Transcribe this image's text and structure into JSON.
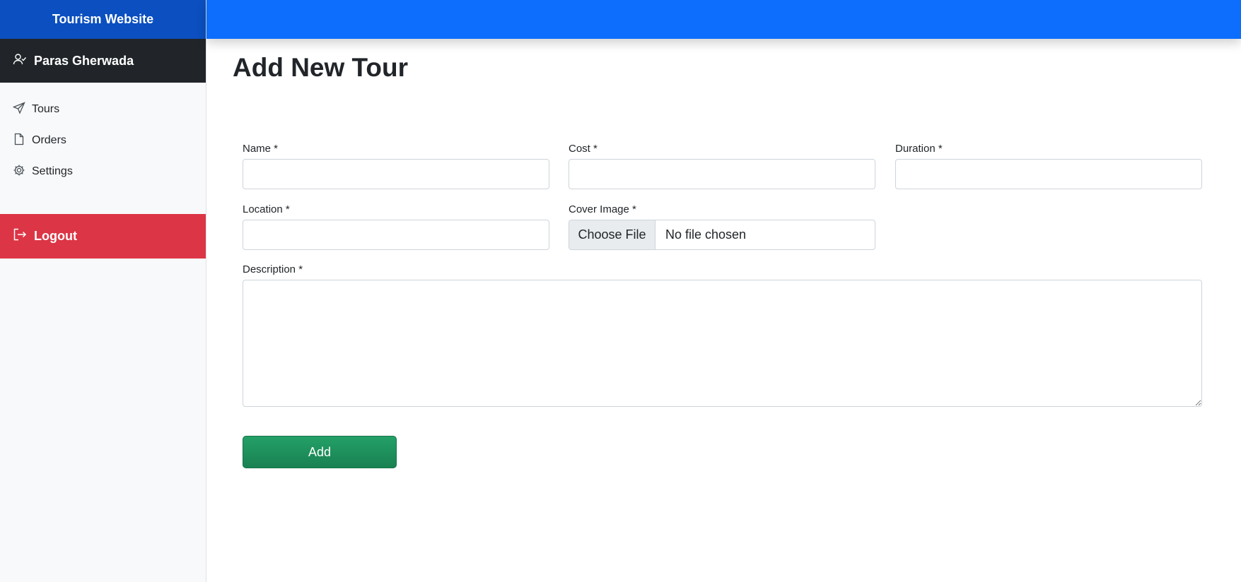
{
  "sidebar": {
    "brand": "Tourism Website",
    "user_name": "Paras Gherwada",
    "items": [
      {
        "label": "Tours",
        "icon": "send-icon"
      },
      {
        "label": "Orders",
        "icon": "file-icon"
      },
      {
        "label": "Settings",
        "icon": "gear-icon"
      }
    ],
    "logout_label": "Logout"
  },
  "main": {
    "title": "Add New Tour",
    "fields": {
      "name": {
        "label": "Name *",
        "value": ""
      },
      "cost": {
        "label": "Cost *",
        "value": ""
      },
      "duration": {
        "label": "Duration *",
        "value": ""
      },
      "location": {
        "label": "Location *",
        "value": ""
      },
      "cover_image": {
        "label": "Cover Image *",
        "button_label": "Choose File",
        "status": "No file chosen"
      },
      "description": {
        "label": "Description *",
        "value": ""
      }
    },
    "submit_label": "Add"
  },
  "colors": {
    "brand": "#0b4fc0",
    "topbar": "#0d6efd",
    "user_bar": "#212529",
    "logout": "#dc3545",
    "submit": "#198754"
  }
}
